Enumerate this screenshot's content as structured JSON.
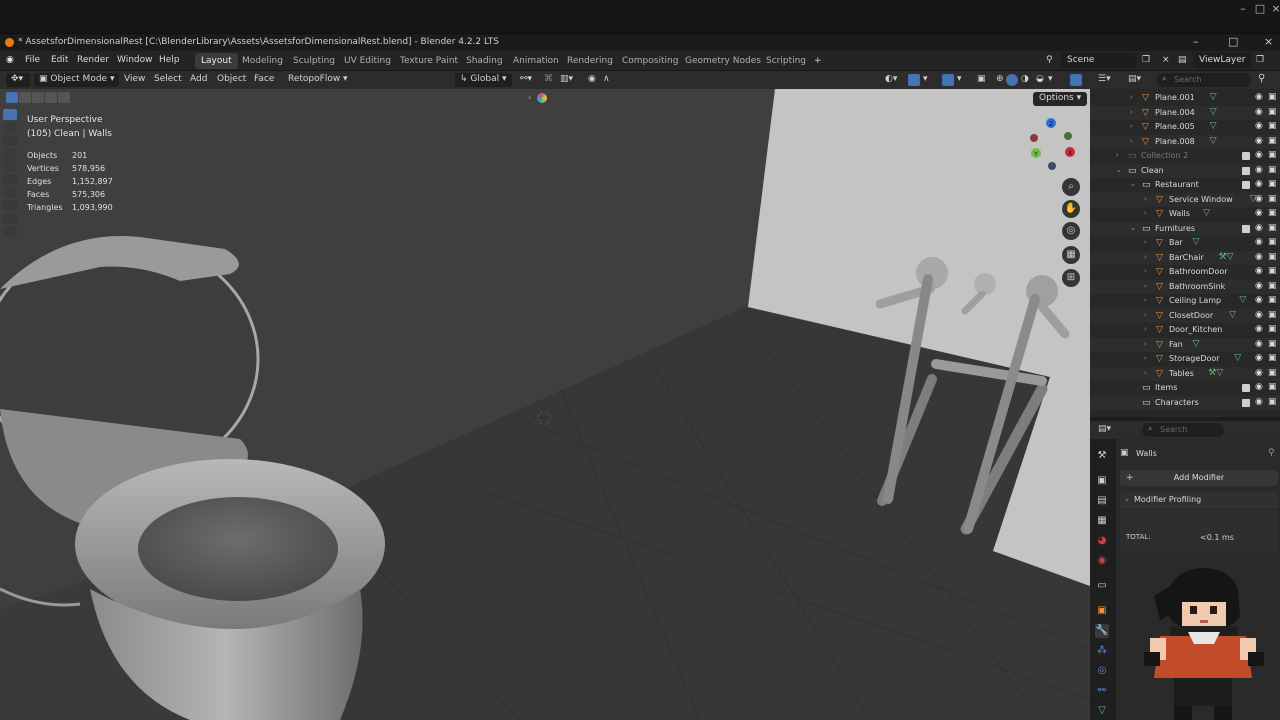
{
  "app": {
    "file_title": "* AssetsforDimensionalRest [C:\\BlenderLibrary\\Assets\\AssetsforDimensionalRest.blend] - Blender 4.2.2 LTS"
  },
  "menu": {
    "items": [
      "File",
      "Edit",
      "Render",
      "Window",
      "Help"
    ],
    "workspaces": [
      "Layout",
      "Modeling",
      "Sculpting",
      "UV Editing",
      "Texture Paint",
      "Shading",
      "Animation",
      "Rendering",
      "Compositing",
      "Geometry Nodes",
      "Scripting"
    ],
    "active_workspace": "Layout",
    "add_workspace": "+",
    "scene": "Scene",
    "view_layer": "ViewLayer"
  },
  "viewport_header": {
    "mode": "Object Mode",
    "view": "View",
    "select": "Select",
    "add": "Add",
    "object": "Object",
    "face": "Face",
    "addon": "RetopoFlow",
    "orientation": "Global",
    "options": "Options"
  },
  "viewport_overlay": {
    "perspective": "User Perspective",
    "collection": "(105) Clean | Walls",
    "stats": [
      {
        "label": "Objects",
        "value": "201"
      },
      {
        "label": "Vertices",
        "value": "578,956"
      },
      {
        "label": "Edges",
        "value": "1,152,897"
      },
      {
        "label": "Faces",
        "value": "575,306"
      },
      {
        "label": "Triangles",
        "value": "1,093,990"
      }
    ],
    "gizmo_labels": {
      "z": "Z",
      "y": "Y",
      "x": "X"
    }
  },
  "outliner": {
    "search_placeholder": "Search",
    "rows": [
      {
        "label": "Plane.001",
        "indent": 2,
        "type": "mesh",
        "arrow": ">",
        "dim": false,
        "col": false
      },
      {
        "label": "Plane.004",
        "indent": 2,
        "type": "mesh",
        "arrow": ">",
        "dim": false,
        "col": false
      },
      {
        "label": "Plane.005",
        "indent": 2,
        "type": "mesh",
        "arrow": ">",
        "dim": false,
        "col": false
      },
      {
        "label": "Plane.008",
        "indent": 2,
        "type": "mesh",
        "arrow": ">",
        "dim": false,
        "col": false
      },
      {
        "label": "Collection 2",
        "indent": 1,
        "type": "collection",
        "arrow": ">",
        "dim": true,
        "col": true
      },
      {
        "label": "Clean",
        "indent": 1,
        "type": "collection",
        "arrow": "v",
        "dim": false,
        "col": true
      },
      {
        "label": "Restaurant",
        "indent": 2,
        "type": "collection",
        "arrow": "v",
        "dim": false,
        "col": true
      },
      {
        "label": "Service Window",
        "indent": 3,
        "type": "mesh",
        "arrow": ">",
        "dim": false,
        "col": false
      },
      {
        "label": "Walls",
        "indent": 3,
        "type": "mesh",
        "arrow": ">",
        "dim": false,
        "col": false
      },
      {
        "label": "Furnitures",
        "indent": 2,
        "type": "collection",
        "arrow": "v",
        "dim": false,
        "col": true
      },
      {
        "label": "Bar",
        "indent": 3,
        "type": "mesh",
        "arrow": ">",
        "dim": false,
        "col": false
      },
      {
        "label": "BarChair",
        "indent": 3,
        "type": "mesh",
        "arrow": ">",
        "dim": false,
        "col": false
      },
      {
        "label": "BathroomDoor",
        "indent": 3,
        "type": "mesh",
        "arrow": ">",
        "dim": false,
        "col": false
      },
      {
        "label": "BathroomSink",
        "indent": 3,
        "type": "mesh",
        "arrow": ">",
        "dim": false,
        "col": false
      },
      {
        "label": "Ceiling Lamp",
        "indent": 3,
        "type": "mesh",
        "arrow": ">",
        "dim": false,
        "col": false
      },
      {
        "label": "ClosetDoor",
        "indent": 3,
        "type": "mesh",
        "arrow": ">",
        "dim": false,
        "col": false
      },
      {
        "label": "Door_Kitchen",
        "indent": 3,
        "type": "mesh",
        "arrow": ">",
        "dim": false,
        "col": false
      },
      {
        "label": "Fan",
        "indent": 3,
        "type": "mesh",
        "arrow": ">",
        "dim": false,
        "col": false
      },
      {
        "label": "StorageDoor",
        "indent": 3,
        "type": "mesh",
        "arrow": ">",
        "dim": false,
        "col": false
      },
      {
        "label": "Tables",
        "indent": 3,
        "type": "mesh",
        "arrow": ">",
        "dim": false,
        "col": false
      },
      {
        "label": "Items",
        "indent": 2,
        "type": "collection",
        "arrow": "",
        "dim": false,
        "col": true
      },
      {
        "label": "Characters",
        "indent": 2,
        "type": "collection",
        "arrow": "",
        "dim": false,
        "col": true
      }
    ]
  },
  "properties": {
    "search_placeholder": "Search",
    "object_name": "Walls",
    "add_modifier": "Add Modifier",
    "panel_title": "Modifier Profiling",
    "total_label": "TOTAL:",
    "total_value": "<0.1 ms"
  },
  "colors": {
    "accent_blue": "#4772b3",
    "mesh_orange": "#e8953a",
    "modifier_green": "#5fc07e",
    "blender_orange": "#e87d0d"
  }
}
